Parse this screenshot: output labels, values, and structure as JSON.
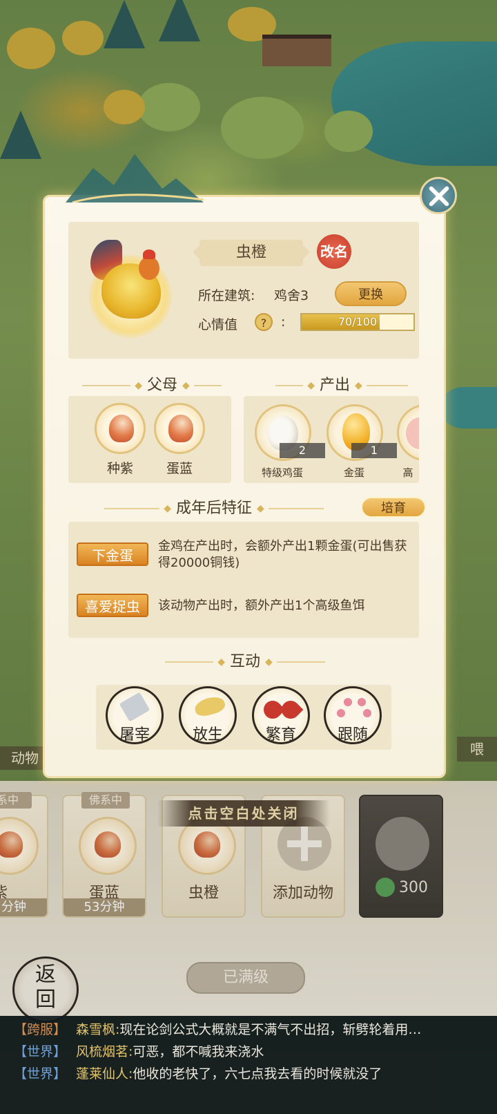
{
  "popup": {
    "animal_name": "虫橙",
    "rename_label": "改名",
    "building_label": "所在建筑:",
    "building_value": "鸡舍3",
    "change_label": "更换",
    "mood_label": "心情值",
    "mood_help_icon": "?",
    "mood_colon": ":",
    "mood_text": "70/100",
    "mood_fraction": 0.7
  },
  "sections": {
    "parents_title": "父母",
    "output_title": "产出",
    "traits_title": "成年后特征",
    "breed_button": "培育",
    "interact_title": "互动"
  },
  "parents": [
    {
      "name": "种紫"
    },
    {
      "name": "蛋蓝"
    }
  ],
  "outputs": [
    {
      "name": "特级鸡蛋",
      "count": "2",
      "icon": "egg-white-icon"
    },
    {
      "name": "金蛋",
      "count": "1",
      "icon": "golden-egg-icon"
    },
    {
      "name": "高",
      "count": "",
      "icon": "ham-icon"
    }
  ],
  "traits": [
    {
      "tag": "下金蛋",
      "desc": "金鸡在产出时，会额外产出1颗金蛋(可出售获得20000铜钱)"
    },
    {
      "tag": "喜爱捉虫",
      "desc": "该动物产出时，额外产出1个高级鱼饵"
    }
  ],
  "actions": [
    {
      "label": "屠宰",
      "icon": "cleaver-icon"
    },
    {
      "label": "放生",
      "icon": "bird-icon"
    },
    {
      "label": "繁育",
      "icon": "heart-icon"
    },
    {
      "label": "跟随",
      "icon": "paw-icon"
    }
  ],
  "background": {
    "close_hint": "点击空白处关闭",
    "left_tab": "动物",
    "right_tab": "喂",
    "slots": [
      {
        "ribbon": "系中",
        "name": "蛋紫",
        "time": "分钟"
      },
      {
        "ribbon": "佛系中",
        "name": "蛋蓝",
        "time": "53分钟"
      },
      {
        "ribbon": "",
        "name": "虫橙",
        "time": ""
      },
      {
        "name": "添加动物"
      },
      {
        "cost": "300"
      }
    ],
    "max_level": "已满级",
    "back_label_top": "返",
    "back_label_bottom": "回"
  },
  "chat": [
    {
      "channel": "【跨服】",
      "who": "森雪枫:",
      "msg": "现在论剑公式大概就是不满气不出招，斩劈轮着用…"
    },
    {
      "channel": "【世界】",
      "who": "风梳烟茗:",
      "msg": "可恶，都不喊我来浇水"
    },
    {
      "channel": "【世界】",
      "who": "蓬莱仙人:",
      "msg": "他收的老快了，六七点我去看的时候就没了"
    }
  ],
  "colors": {
    "accent_gold": "#e2a63e",
    "trait_tag": "#d98322",
    "chat_channel": "#6fa1d8",
    "chat_name": "#e2c36b"
  }
}
